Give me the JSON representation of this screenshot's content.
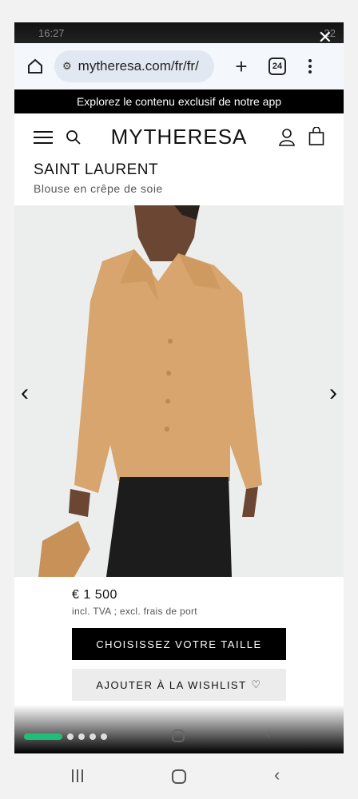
{
  "status_bar": {
    "time": "16:27",
    "right_text": "22"
  },
  "browser": {
    "url": "mytheresa.com/fr/fr/",
    "tab_count": "24",
    "plus_label": "+"
  },
  "promo": {
    "text": "Explorez le contenu exclusif de notre app"
  },
  "site": {
    "logo": "MYTHERESA"
  },
  "product": {
    "brand": "SAINT LAURENT",
    "name": "Blouse en crêpe de soie",
    "price": "€ 1 500",
    "tax_note": "incl. TVA ; excl. frais de port",
    "choose_size_label": "CHOISISSEZ VOTRE TAILLE",
    "wishlist_label": "AJOUTER À LA WISHLIST",
    "wishlist_heart": "♡"
  },
  "gallery": {
    "prev_arrow": "‹",
    "next_arrow": "›"
  },
  "colors": {
    "blouse": "#d7a56d",
    "pants": "#1c1c1c",
    "background": "#eceeed",
    "pill": "#1fbf7a"
  }
}
